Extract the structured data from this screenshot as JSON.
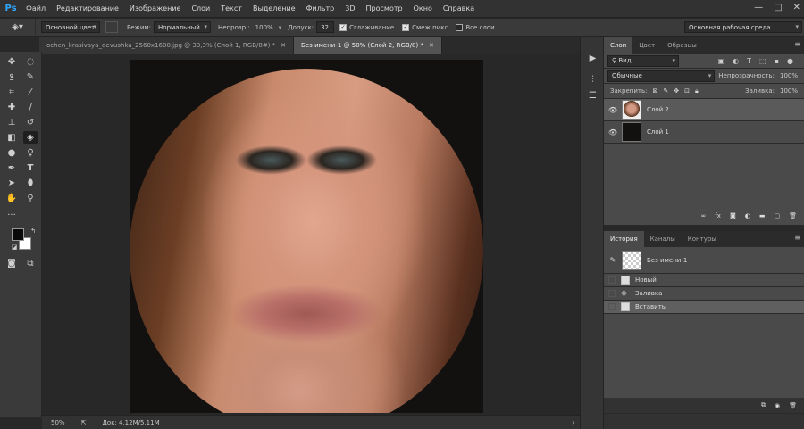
{
  "app": {
    "logo": "Ps",
    "menu": [
      "Файл",
      "Редактирование",
      "Изображение",
      "Слои",
      "Текст",
      "Выделение",
      "Фильтр",
      "3D",
      "Просмотр",
      "Окно",
      "Справка"
    ],
    "window_controls": [
      "—",
      "□",
      "✕"
    ]
  },
  "options": {
    "fill_source": "Основной цвет",
    "mode_label": "Режим:",
    "mode_value": "Нормальный",
    "opacity_label": "Непрозр.:",
    "opacity_value": "100%",
    "tolerance_label": "Допуск:",
    "tolerance_value": "32",
    "antialias_label": "Сглаживание",
    "contiguous_label": "Смеж.пикс",
    "all_layers_label": "Все слои",
    "workspace": "Основная рабочая среда"
  },
  "tabs": [
    {
      "label": "ochen_krasivaya_devushka_2560x1600.jpg @ 33,3% (Слой 1, RGB/8#) *"
    },
    {
      "label": "Без имени-1 @ 50% (Слой 2, RGB/8) *"
    }
  ],
  "status": {
    "zoom": "50%",
    "doc": "Док: 4,12M/5,11M"
  },
  "layers_panel": {
    "tabs": [
      "Слои",
      "Цвет",
      "Образцы"
    ],
    "filter_kind": "Вид",
    "blend_mode": "Обычные",
    "opacity_label": "Непрозрачность:",
    "opacity_value": "100%",
    "lock_label": "Закрепить:",
    "fill_label": "Заливка:",
    "fill_value": "100%",
    "layers": [
      {
        "name": "Слой 2",
        "selected": true
      },
      {
        "name": "Слой 1",
        "selected": false
      }
    ]
  },
  "history_panel": {
    "tabs": [
      "История",
      "Каналы",
      "Контуры"
    ],
    "snapshot": "Без имени-1",
    "items": [
      {
        "name": "Новый",
        "selected": false
      },
      {
        "name": "Заливка",
        "selected": false
      },
      {
        "name": "Вставить",
        "selected": true
      }
    ]
  },
  "colors": {
    "accent": "#31a8ff",
    "foreground": "#0a0a0a",
    "background": "#ffffff"
  }
}
